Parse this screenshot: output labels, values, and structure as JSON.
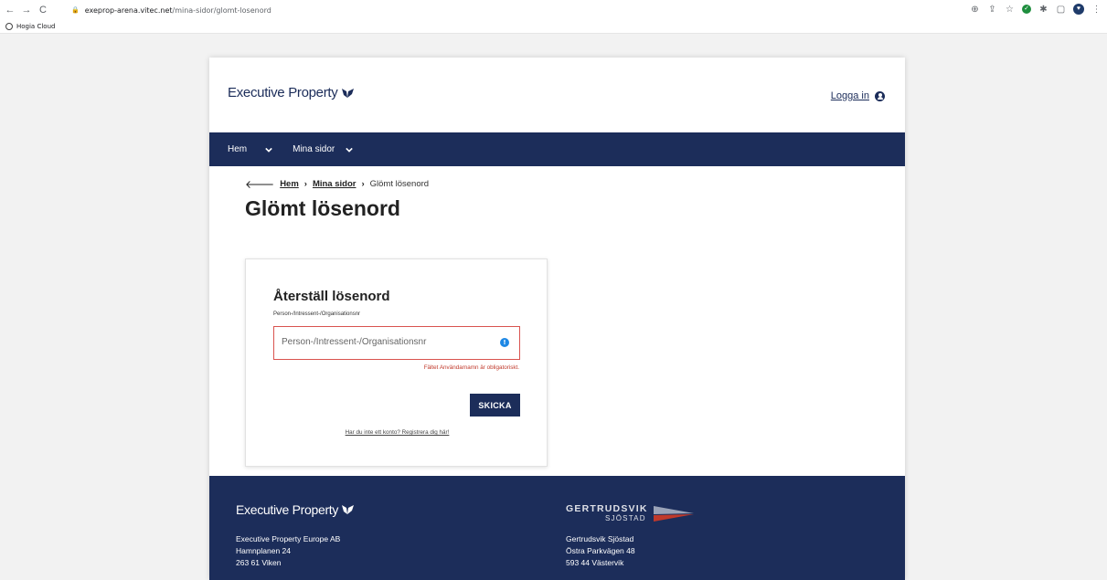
{
  "browser": {
    "url_host": "exeprop-arena.vitec.net",
    "url_path": "/mina-sidor/glomt-losenord",
    "bookmark": "Hogia Cloud"
  },
  "header": {
    "logo_text": "Executive Property",
    "login_label": "Logga in"
  },
  "nav": {
    "items": [
      {
        "label": "Hem"
      },
      {
        "label": "Mina sidor"
      }
    ]
  },
  "breadcrumb": {
    "home": "Hem",
    "mina_sidor": "Mina sidor",
    "current": "Glömt lösenord"
  },
  "page_title": "Glömt lösenord",
  "form": {
    "title": "Återställ lösenord",
    "field_label": "Person-/Intressent-/Organisationsnr",
    "field_placeholder": "Person-/Intressent-/Organisationsnr",
    "field_value": "",
    "error": "Fältet Användarnamn är obligatoriskt.",
    "submit_label": "SKICKA",
    "register_link": "Har du inte ett konto? Registrera dig här!"
  },
  "footer": {
    "logo_text": "Executive Property",
    "left_address": [
      "Executive Property Europe AB",
      "Hamnplanen 24",
      "263 61 Viken"
    ],
    "right_logo_line1": "GERTRUDSVIK",
    "right_logo_line2": "SJÖSTAD",
    "right_address": [
      "Gertrudsvik Sjöstad",
      "Östra Parkvägen 48",
      "593 44 Västervik"
    ]
  },
  "colors": {
    "brand_navy": "#1c2d5a",
    "error_red": "#d9534f",
    "info_blue": "#1e88e5"
  }
}
